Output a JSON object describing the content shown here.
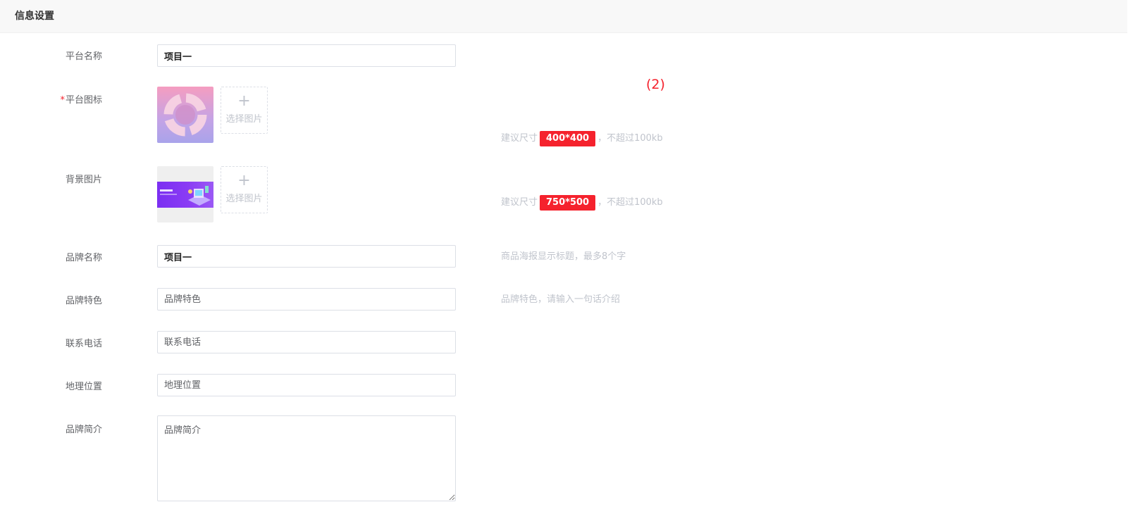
{
  "header": {
    "title": "信息设置"
  },
  "marker": "(2)",
  "form": {
    "platform_name": {
      "label": "平台名称",
      "value": "项目一"
    },
    "platform_icon": {
      "required_mark": "*",
      "label": "平台图标",
      "picker_plus": "+",
      "picker_label": "选择图片",
      "hint_prefix": "建议尺寸",
      "hint_size": "400*400",
      "hint_suffix": "，不超过100kb"
    },
    "background_image": {
      "label": "背景图片",
      "picker_plus": "+",
      "picker_label": "选择图片",
      "hint_prefix": "建议尺寸",
      "hint_size": "750*500",
      "hint_suffix": "，不超过100kb"
    },
    "brand_name": {
      "label": "品牌名称",
      "value": "项目一",
      "hint": "商品海报显示标题，最多8个字"
    },
    "brand_feature": {
      "label": "品牌特色",
      "placeholder": "品牌特色",
      "hint": "品牌特色，请输入一句话介绍"
    },
    "phone": {
      "label": "联系电话",
      "placeholder": "联系电话"
    },
    "location": {
      "label": "地理位置",
      "placeholder": "地理位置"
    },
    "brand_intro": {
      "label": "品牌简介",
      "placeholder": "品牌简介"
    }
  },
  "colors": {
    "accent_red": "#f5222d",
    "hint_gray": "#c0c4cc",
    "label_gray": "#606266",
    "border": "#dcdfe6"
  }
}
